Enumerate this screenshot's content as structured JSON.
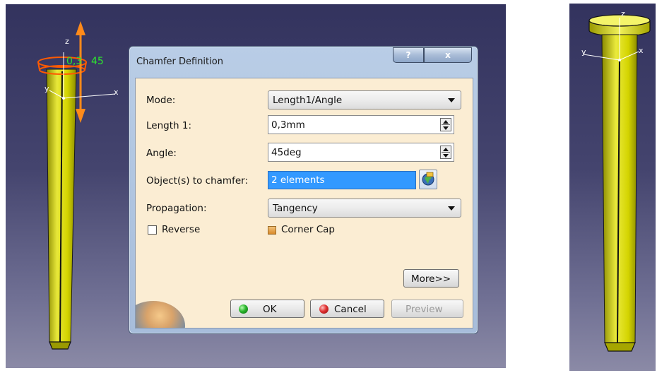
{
  "viewport_left": {
    "axis": {
      "x": "x",
      "y": "y",
      "z": "z"
    },
    "dimension_length": "0,3",
    "dimension_angle": "45"
  },
  "viewport_right": {
    "axis": {
      "x": "x",
      "y": "y",
      "z": "z"
    }
  },
  "dialog": {
    "title": "Chamfer Definition",
    "help_label": "?",
    "close_label": "x",
    "mode": {
      "label": "Mode:",
      "value": "Length1/Angle"
    },
    "length1": {
      "label": "Length 1:",
      "value": "0,3mm"
    },
    "angle": {
      "label": "Angle:",
      "value": "45deg"
    },
    "objects": {
      "label": "Object(s) to chamfer:",
      "value": "2 elements"
    },
    "propagation": {
      "label": "Propagation:",
      "value": "Tangency"
    },
    "reverse": {
      "label": "Reverse",
      "checked": false
    },
    "corner_cap": {
      "label": "Corner Cap",
      "checked": true
    },
    "more_label": "More>>",
    "ok_label": "OK",
    "cancel_label": "Cancel",
    "preview_label": "Preview"
  },
  "colors": {
    "rod": "#d4d400",
    "selection": "#ff6a00",
    "dimension": "#2ee82e",
    "field_highlight": "#3399ff"
  }
}
